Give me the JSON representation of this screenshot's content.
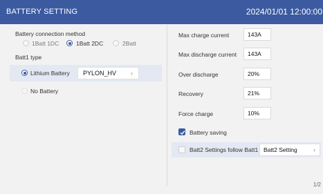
{
  "header": {
    "title": "BATTERY SETTING",
    "datetime": "2024/01/01 12:00:00"
  },
  "left": {
    "connection_title": "Battery connection method",
    "connection_options": [
      {
        "label": "1Batt 1DC",
        "checked": false
      },
      {
        "label": "1Batt 2DC",
        "checked": true
      },
      {
        "label": "2Batt",
        "checked": false
      }
    ],
    "batt1_type_title": "Batt1 type",
    "lithium_label": "Lithium Battery",
    "lithium_checked": true,
    "lithium_select_value": "PYLON_HV",
    "no_battery_label": "No Battery",
    "no_battery_checked": false
  },
  "right": {
    "fields": [
      {
        "label": "Max charge current",
        "value": "143A"
      },
      {
        "label": "Max discharge current",
        "value": "143A"
      },
      {
        "label": "Over discharge",
        "value": "20%"
      },
      {
        "label": "Recovery",
        "value": "21%"
      },
      {
        "label": "Force charge",
        "value": "10%"
      }
    ],
    "battery_saving_label": "Battery saving",
    "battery_saving_checked": true,
    "batt2_follow_label": "Batt2 Settings follow Batt1",
    "batt2_follow_checked": false,
    "batt2_setting_label": "Batt2 Setting"
  },
  "page_indicator": "1/2",
  "colors": {
    "header": "#3b5aa0",
    "accent": "#3b5aa0",
    "background": "#f2f2f2",
    "row_highlight": "#e3e8f2"
  },
  "icons": {
    "chevron": "chevron-right-icon",
    "check": "check-icon"
  }
}
